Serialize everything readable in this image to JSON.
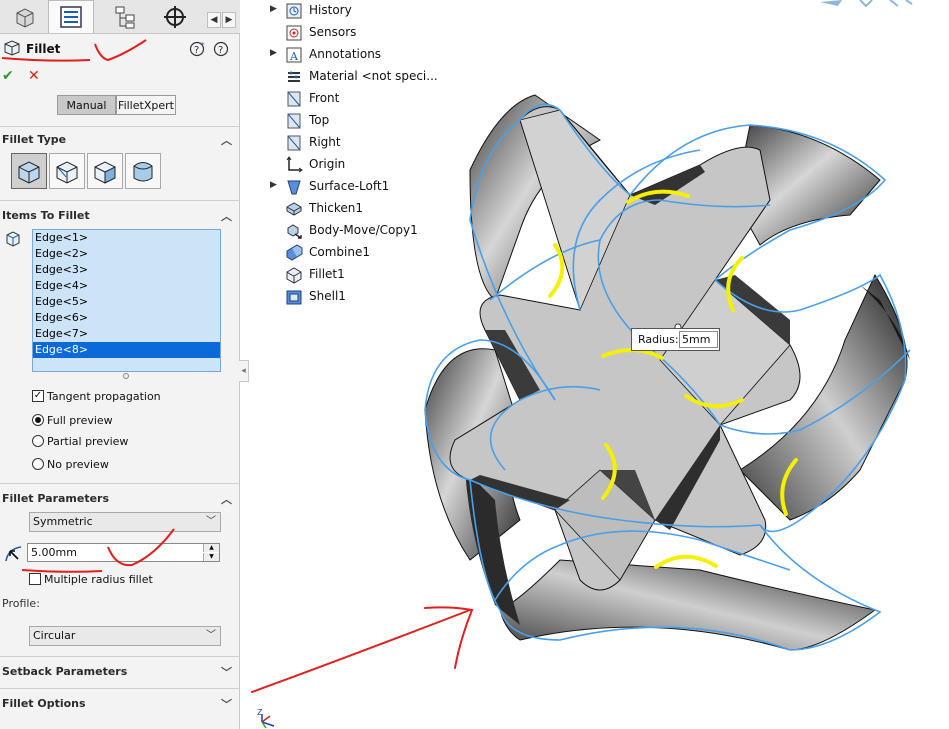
{
  "panel": {
    "title": "Fillet",
    "ok_symbol": "✔",
    "cancel_symbol": "✕",
    "mode_tabs": [
      "Manual",
      "FilletXpert"
    ],
    "fillet_type_label": "Fillet Type",
    "items_label": "Items To Fillet",
    "edges": [
      "Edge<1>",
      "Edge<2>",
      "Edge<3>",
      "Edge<4>",
      "Edge<5>",
      "Edge<6>",
      "Edge<7>",
      "Edge<8>"
    ],
    "tangent_propagation": "Tangent propagation",
    "preview_options": [
      "Full preview",
      "Partial preview",
      "No preview"
    ],
    "params_label": "Fillet Parameters",
    "symmetry_value": "Symmetric",
    "radius_value": "5.00mm",
    "multiple_radius": "Multiple radius fillet",
    "profile_label": "Profile:",
    "profile_value": "Circular",
    "setback_label": "Setback Parameters",
    "options_label": "Fillet Options"
  },
  "tree": {
    "items": [
      {
        "label": "History",
        "expandable": true,
        "icon": "history-icon"
      },
      {
        "label": "Sensors",
        "expandable": false,
        "icon": "sensors-icon"
      },
      {
        "label": "Annotations",
        "expandable": true,
        "icon": "annotations-icon"
      },
      {
        "label": "Material <not speci...",
        "expandable": false,
        "icon": "material-icon"
      },
      {
        "label": "Front",
        "expandable": false,
        "icon": "plane-icon"
      },
      {
        "label": "Top",
        "expandable": false,
        "icon": "plane-icon"
      },
      {
        "label": "Right",
        "expandable": false,
        "icon": "plane-icon"
      },
      {
        "label": "Origin",
        "expandable": false,
        "icon": "origin-icon"
      },
      {
        "label": "Surface-Loft1",
        "expandable": true,
        "icon": "loft-icon"
      },
      {
        "label": "Thicken1",
        "expandable": false,
        "icon": "thicken-icon"
      },
      {
        "label": "Body-Move/Copy1",
        "expandable": false,
        "icon": "move-copy-icon"
      },
      {
        "label": "Combine1",
        "expandable": false,
        "icon": "combine-icon"
      },
      {
        "label": "Fillet1",
        "expandable": false,
        "icon": "fillet-icon"
      },
      {
        "label": "Shell1",
        "expandable": false,
        "icon": "shell-icon"
      }
    ]
  },
  "viewport": {
    "radius_label": "Radius:",
    "radius_value": "5mm",
    "triad_label": "Z"
  },
  "colors": {
    "selection_blue": "#0a6ad8",
    "edge_highlight": "#4a9fe8",
    "fillet_preview": "#f4f000",
    "annotation_red": "#e0201f"
  }
}
